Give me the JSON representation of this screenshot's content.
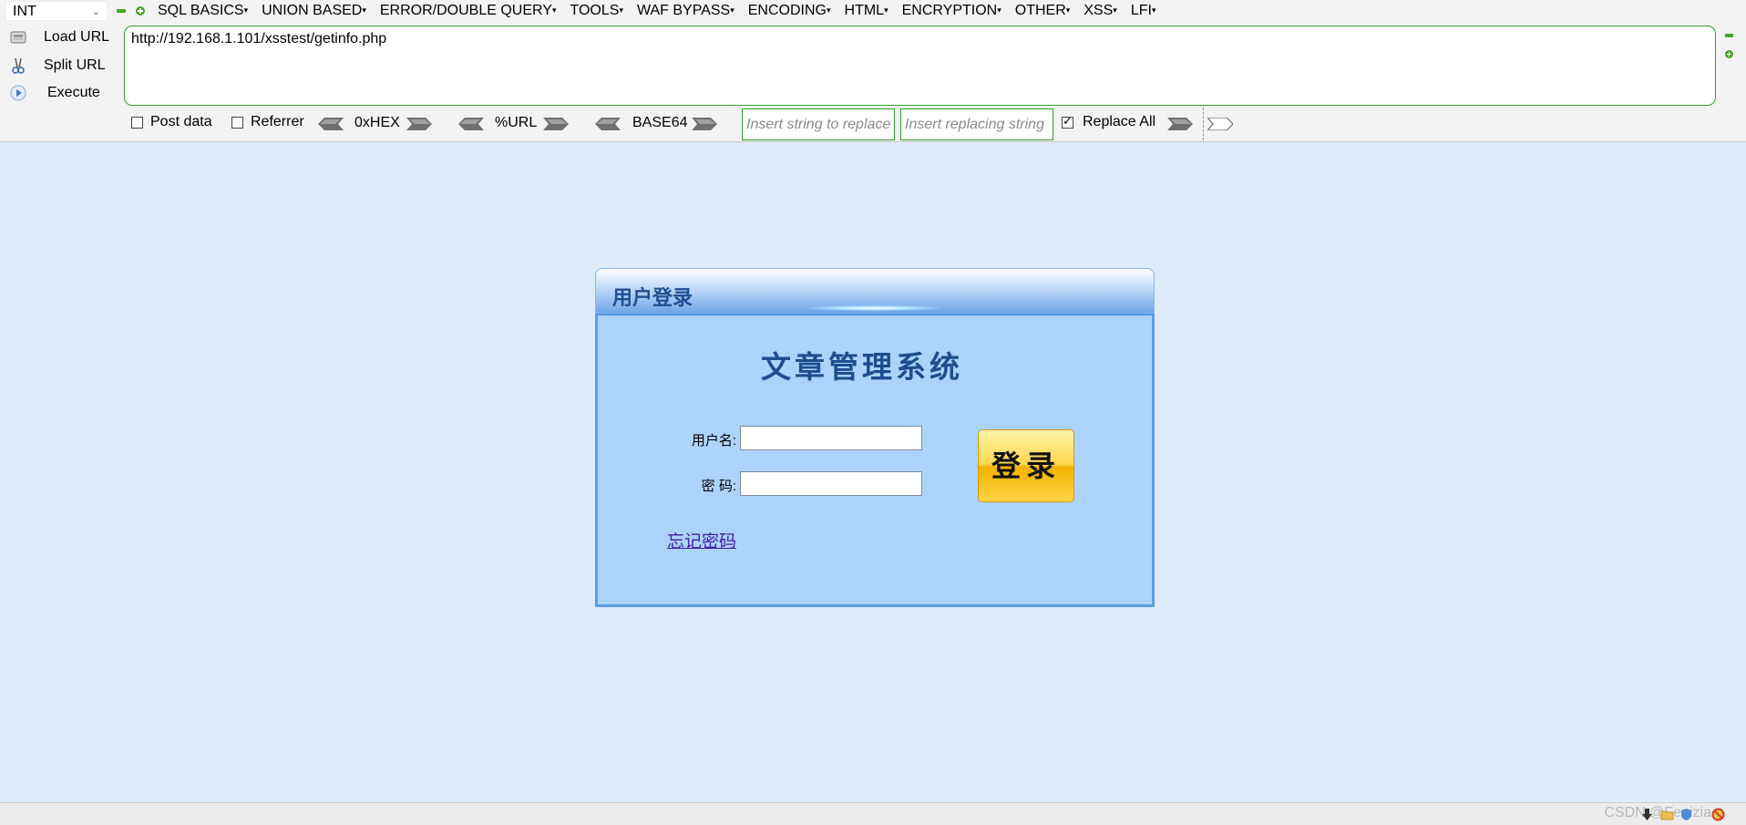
{
  "hackbar": {
    "select_value": "INT",
    "menus": [
      "SQL BASICS",
      "UNION BASED",
      "ERROR/DOUBLE QUERY",
      "TOOLS",
      "WAF BYPASS",
      "ENCODING",
      "HTML",
      "ENCRYPTION",
      "OTHER",
      "XSS",
      "LFI"
    ],
    "actions": {
      "load_url": "Load URL",
      "split_url": "Split URL",
      "execute": "Execute"
    },
    "url": "http://192.168.1.101/xsstest/getinfo.php",
    "options": {
      "post_data": "Post data",
      "referrer": "Referrer",
      "hex": "0xHEX",
      "url_enc": "%URL",
      "base64": "BASE64",
      "replace_placeholder": "Insert string to replace",
      "replacing_placeholder": "Insert replacing string",
      "replace_all": "Replace All",
      "replace_all_checked": true,
      "post_data_checked": false,
      "referrer_checked": false
    }
  },
  "login": {
    "header_title": "用户登录",
    "system_title": "文章管理系统",
    "username_label": "用户名:",
    "password_label": "密 码:",
    "login_button": "登录",
    "forgot_password": "忘记密码"
  },
  "statusbar": {
    "watermark": "CSDN @Fenizia"
  },
  "colors": {
    "page_bg": "#dcecfb",
    "accent_green": "#2f9e2f",
    "login_body": "#acd3fb",
    "login_border": "#5d9ee6",
    "title_blue": "#1d4d8f",
    "link_purple": "#3f1fa8"
  }
}
